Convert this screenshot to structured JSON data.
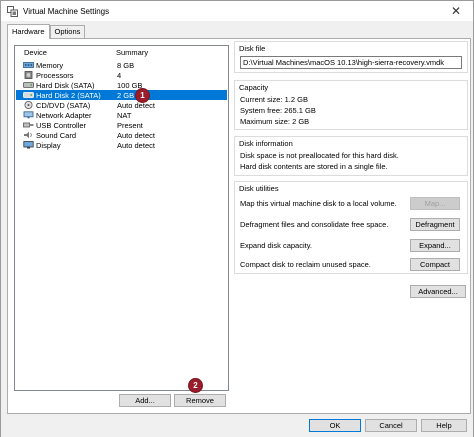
{
  "window": {
    "title": "Virtual Machine Settings"
  },
  "tabs": [
    {
      "label": "Hardware"
    },
    {
      "label": "Options"
    }
  ],
  "device_list": {
    "headers": {
      "device": "Device",
      "summary": "Summary"
    },
    "rows": [
      {
        "name": "Memory",
        "summary": "8 GB",
        "icon": "memory-icon"
      },
      {
        "name": "Processors",
        "summary": "4",
        "icon": "processor-icon"
      },
      {
        "name": "Hard Disk (SATA)",
        "summary": "100 GB",
        "icon": "hard-disk-icon"
      },
      {
        "name": "Hard Disk 2 (SATA)",
        "summary": "2 GB",
        "icon": "hard-disk-icon"
      },
      {
        "name": "CD/DVD (SATA)",
        "summary": "Auto detect",
        "icon": "cd-dvd-icon"
      },
      {
        "name": "Network Adapter",
        "summary": "NAT",
        "icon": "network-adapter-icon"
      },
      {
        "name": "USB Controller",
        "summary": "Present",
        "icon": "usb-icon"
      },
      {
        "name": "Sound Card",
        "summary": "Auto detect",
        "icon": "sound-card-icon"
      },
      {
        "name": "Display",
        "summary": "Auto detect",
        "icon": "display-icon"
      }
    ]
  },
  "badges": {
    "one": "1",
    "two": "2"
  },
  "list_buttons": {
    "add": "Add...",
    "remove": "Remove"
  },
  "disk_file": {
    "title": "Disk file",
    "path": "D:\\Virtual Machines\\macOS 10.13\\high-sierra-recovery.vmdk"
  },
  "capacity": {
    "title": "Capacity",
    "current_size": "Current size: 1.2 GB",
    "system_free": "System free: 265.1 GB",
    "maximum_size": "Maximum size: 2 GB"
  },
  "disk_information": {
    "title": "Disk information",
    "line1": "Disk space is not preallocated for this hard disk.",
    "line2": "Hard disk contents are stored in a single file."
  },
  "disk_utilities": {
    "title": "Disk utilities",
    "map_text": "Map this virtual machine disk to a local volume.",
    "map_button": "Map...",
    "defrag_text": "Defragment files and consolidate free space.",
    "defrag_button": "Defragment",
    "expand_text": "Expand disk capacity.",
    "expand_button": "Expand...",
    "compact_text": "Compact disk to reclaim unused space.",
    "compact_button": "Compact"
  },
  "advanced_button": "Advanced...",
  "footer": {
    "ok": "OK",
    "cancel": "Cancel",
    "help": "Help"
  },
  "colors": {
    "selection": "#0078d7",
    "badge": "#9b1c2a"
  }
}
